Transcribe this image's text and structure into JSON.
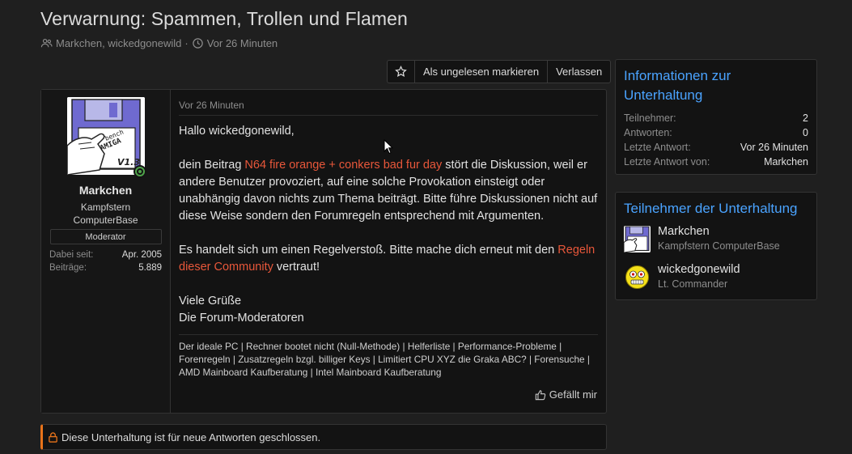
{
  "thread": {
    "title": "Verwarnung: Spammen, Trollen und Flamen",
    "participants_text": "Markchen, wickedgonewild",
    "time_text": "Vor 26 Minuten"
  },
  "actions": {
    "mark_unread": "Als ungelesen markieren",
    "leave": "Verlassen"
  },
  "post": {
    "author": {
      "name": "Markchen",
      "title_line1": "Kampfstern",
      "title_line2": "ComputerBase",
      "role": "Moderator",
      "joined_label": "Dabei seit:",
      "joined_value": "Apr. 2005",
      "posts_label": "Beiträge:",
      "posts_value": "5.889",
      "avatar_text": "V1.3"
    },
    "date": "Vor 26 Minuten",
    "greeting": "Hallo wickedgonewild,",
    "p1_before": "dein Beitrag ",
    "p1_link": "N64 fire orange + conkers bad fur day",
    "p1_after": " stört die Diskussion, weil er andere Benutzer provoziert, auf eine solche Provokation einsteigt oder unabhängig davon nichts zum Thema beiträgt. Bitte führe Diskussionen nicht auf diese Weise sondern den Forumregeln entsprechend mit Argumenten.",
    "p2_before": "Es handelt sich um einen Regelverstoß. Bitte mache dich erneut mit den ",
    "p2_link": "Regeln dieser Community",
    "p2_after": " vertraut!",
    "sign_line1": "Viele Grüße",
    "sign_line2": "Die Forum-Moderatoren",
    "signature": "Der ideale PC | Rechner bootet nicht (Null-Methode) | Helferliste | Performance-Probleme | Forenregeln | Zusatzregeln bzgl. billiger Keys | Limitiert CPU XYZ die Graka ABC? | Forensuche | AMD Mainboard Kaufberatung | Intel Mainboard Kaufberatung",
    "like_label": "Gefällt mir"
  },
  "locked_notice": "Diese Unterhaltung ist für neue Antworten geschlossen.",
  "info_block": {
    "title": "Informationen zur Unterhaltung",
    "rows": [
      {
        "k": "Teilnehmer:",
        "v": "2"
      },
      {
        "k": "Antworten:",
        "v": "0"
      },
      {
        "k": "Letzte Antwort:",
        "v": "Vor 26 Minuten"
      },
      {
        "k": "Letzte Antwort von:",
        "v": "Markchen"
      }
    ]
  },
  "participants_block": {
    "title": "Teilnehmer der Unterhaltung",
    "items": [
      {
        "name": "Markchen",
        "sub": "Kampfstern ComputerBase"
      },
      {
        "name": "wickedgonewild",
        "sub": "Lt. Commander"
      }
    ]
  },
  "colors": {
    "background": "#1f1f1f",
    "panel": "#131313",
    "link_accent": "#e8573a",
    "block_title": "#4aa3ff",
    "locked_border": "#e8731a",
    "online": "#4fa34a"
  }
}
